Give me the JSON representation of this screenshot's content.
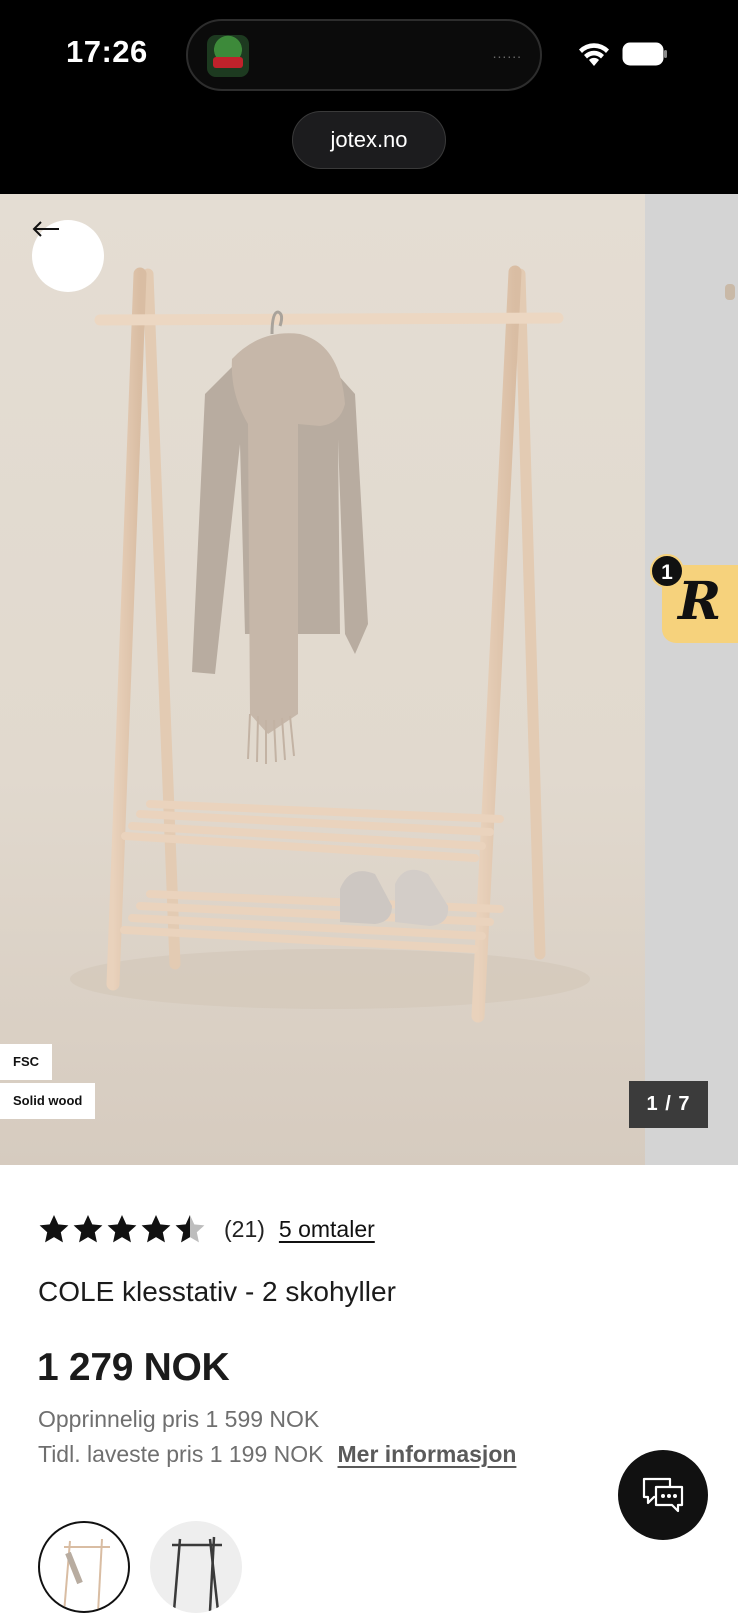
{
  "status_bar": {
    "time": "17:26",
    "island_dots": "......",
    "icons": [
      "app-thumbnail-icon",
      "wifi-icon",
      "battery-icon"
    ]
  },
  "browser": {
    "url": "jotex.no"
  },
  "gallery": {
    "badges": [
      "FSC",
      "Solid wood"
    ],
    "counter": "1 / 7",
    "review_widget": {
      "letter": "R",
      "count": "1",
      "color": "#f6d27c"
    }
  },
  "product": {
    "rating": 4.5,
    "rating_count": "(21)",
    "reviews_link": "5 omtaler",
    "title": "COLE klesstativ - 2 skohyller",
    "price": "1 279 NOK",
    "original_price": "Opprinnelig pris 1 599 NOK",
    "previous_lowest": "Tidl. laveste pris 1 199 NOK",
    "more_info": "Mer informasjon",
    "swatches": [
      "natural-wood",
      "black"
    ]
  },
  "colors": {
    "accent": "#111111",
    "muted_text": "#6f6f6f"
  }
}
